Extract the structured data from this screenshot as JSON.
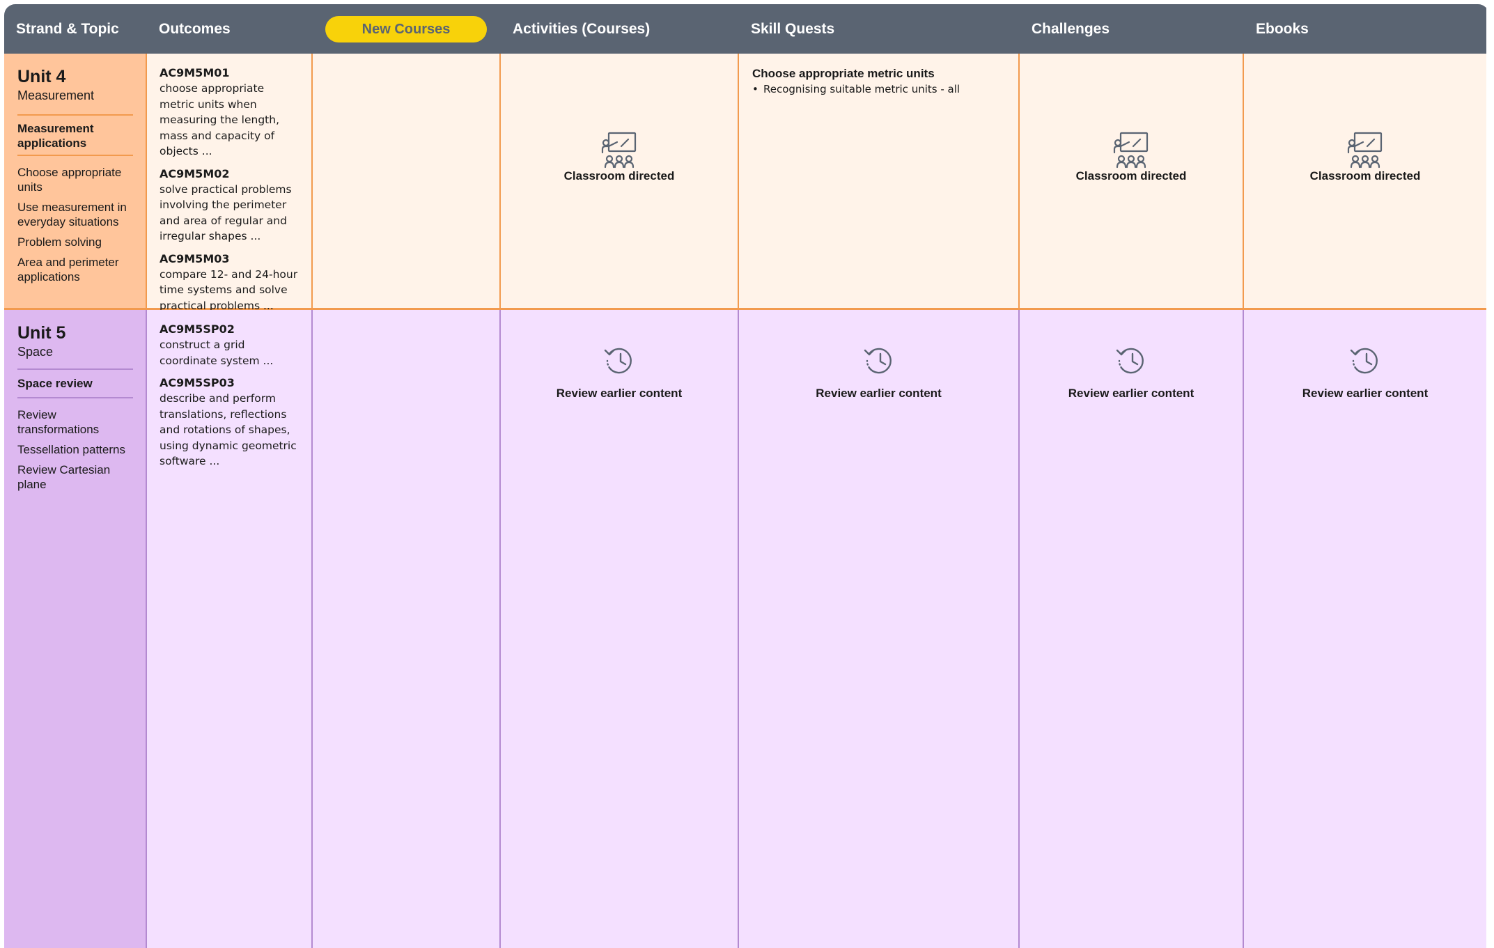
{
  "header": {
    "strand_topic": "Strand & Topic",
    "outcomes": "Outcomes",
    "new_courses": "New Courses",
    "activities": "Activities (Courses)",
    "skill_quests": "Skill Quests",
    "challenges": "Challenges",
    "ebooks": "Ebooks"
  },
  "colors": {
    "header_bg": "#5a6472",
    "pill_bg": "#f8d20a",
    "unit4_topic_bg": "#ffc59b",
    "unit4_bg": "#fff3e9",
    "unit4_line": "#f29a4e",
    "unit5_topic_bg": "#ddb8f0",
    "unit5_bg": "#f4e0ff",
    "unit5_line": "#b48ad1"
  },
  "unit4": {
    "title": "Unit 4",
    "subtitle": "Measurement",
    "strand": "Measurement applications",
    "subtopics": [
      "Choose appropriate units",
      "Use measurement in everyday situations",
      "Problem solving",
      "Area and perimeter applications"
    ],
    "outcomes": [
      {
        "code": "AC9M5M01",
        "desc": "choose appropriate metric units when measuring the length, mass and capacity of objects ..."
      },
      {
        "code": "AC9M5M02",
        "desc": "solve practical problems involving the perimeter and area of regular and irregular shapes ..."
      },
      {
        "code": "AC9M5M03",
        "desc": "compare 12- and 24-hour time systems and solve practical problems ..."
      }
    ],
    "activities": {
      "icon": "classroom-teacher-icon",
      "label": "Classroom directed"
    },
    "skill_quests": {
      "title": "Choose appropriate metric units",
      "bullet": "•",
      "items": [
        "Recognising suitable metric units - all"
      ]
    },
    "challenges": {
      "icon": "classroom-teacher-icon",
      "label": "Classroom directed"
    },
    "ebooks": {
      "icon": "classroom-teacher-icon",
      "label": "Classroom directed"
    }
  },
  "unit5": {
    "title": "Unit 5",
    "subtitle": "Space",
    "strand": "Space review",
    "subtopics": [
      "Review transformations",
      "Tessellation patterns",
      "Review Cartesian plane"
    ],
    "outcomes": [
      {
        "code": "AC9M5SP02",
        "desc": "construct a grid coordinate system ..."
      },
      {
        "code": "AC9M5SP03",
        "desc": "describe and perform translations, reflections and rotations of shapes, using dynamic geometric software ..."
      }
    ],
    "activities": {
      "icon": "history-icon",
      "label": "Review earlier content"
    },
    "skill_quests": {
      "icon": "history-icon",
      "label": "Review earlier content"
    },
    "challenges": {
      "icon": "history-icon",
      "label": "Review earlier content"
    },
    "ebooks": {
      "icon": "history-icon",
      "label": "Review earlier content"
    }
  }
}
